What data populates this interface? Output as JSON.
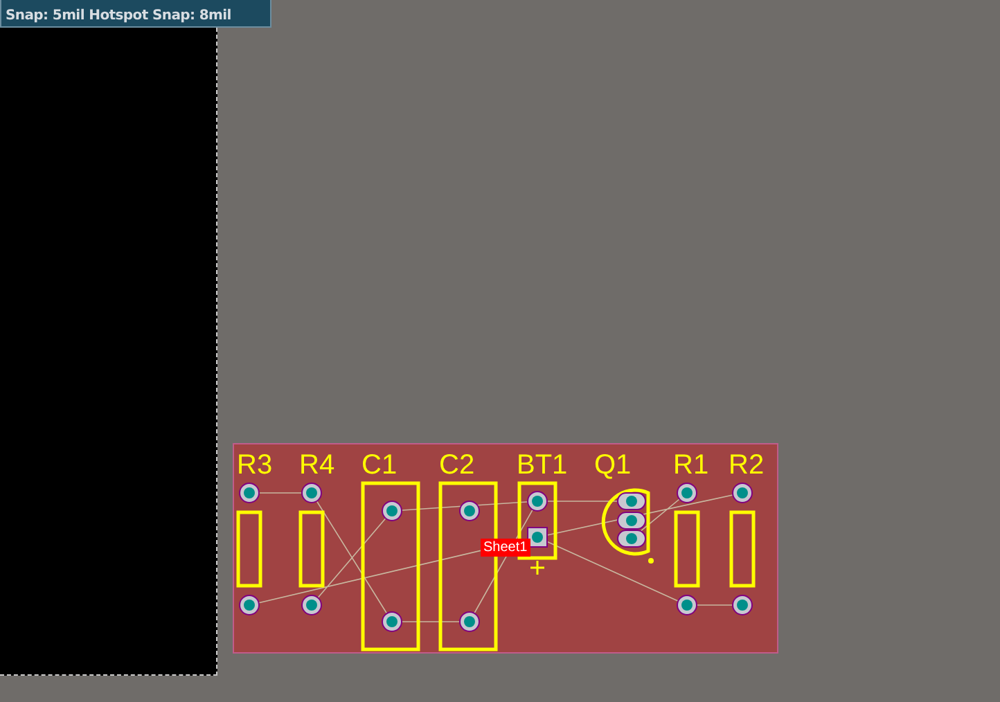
{
  "status": {
    "snap_info": "Snap: 5mil Hotspot Snap: 8mil"
  },
  "board": {
    "components": [
      {
        "designator": "R3",
        "kind": "resistor"
      },
      {
        "designator": "R4",
        "kind": "resistor"
      },
      {
        "designator": "C1",
        "kind": "capacitor"
      },
      {
        "designator": "C2",
        "kind": "capacitor"
      },
      {
        "designator": "BT1",
        "kind": "battery"
      },
      {
        "designator": "Q1",
        "kind": "transistor"
      },
      {
        "designator": "R1",
        "kind": "resistor"
      },
      {
        "designator": "R2",
        "kind": "resistor"
      }
    ],
    "sheet_label": "Sheet1"
  }
}
